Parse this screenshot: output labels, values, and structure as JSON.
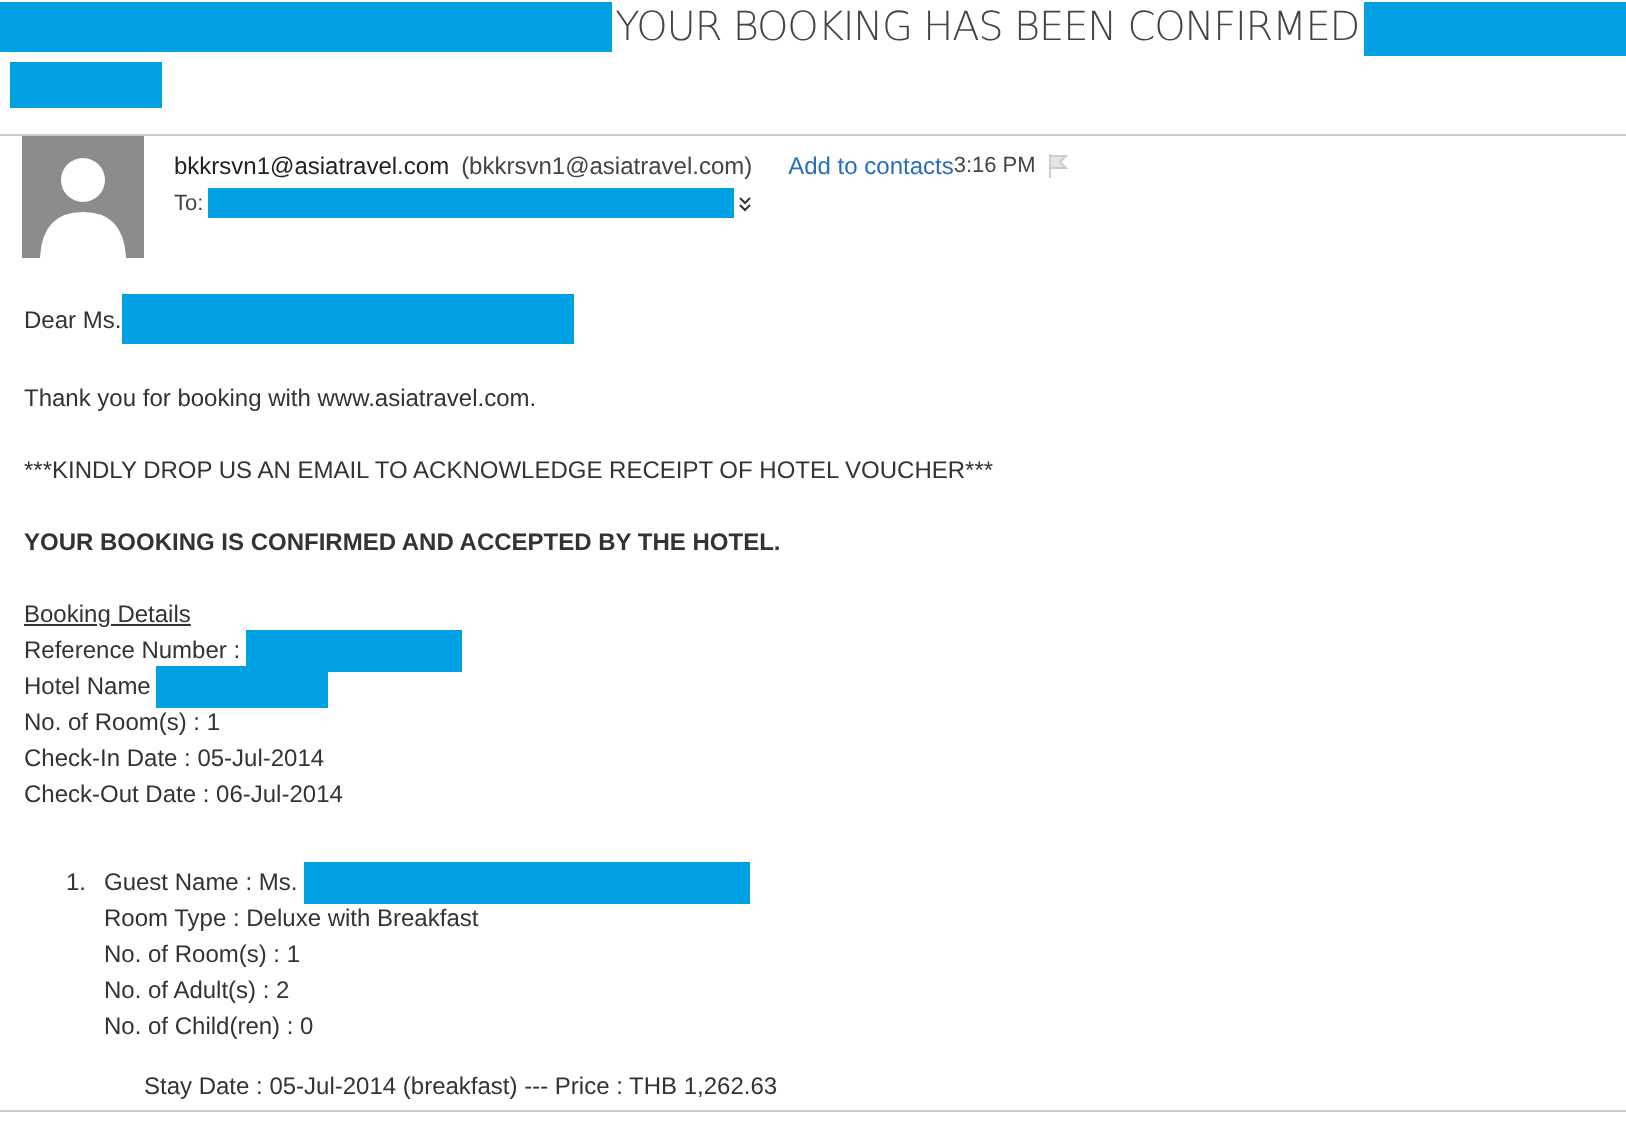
{
  "subject": "YOUR BOOKING HAS BEEN CONFIRMED",
  "header": {
    "sender": "bkkrsvn1@asiatravel.com",
    "sender_address": "(bkkrsvn1@asiatravel.com)",
    "add_contact": "Add to contacts",
    "time": "3:16 PM",
    "to_label": "To:"
  },
  "body": {
    "greeting": "Dear Ms.",
    "thanks": "Thank you for booking with www.asiatravel.com.",
    "notice": "***KINDLY DROP US AN EMAIL TO ACKNOWLEDGE RECEIPT OF HOTEL VOUCHER***",
    "confirmation": "YOUR BOOKING IS CONFIRMED AND ACCEPTED BY THE HOTEL.",
    "details_heading": "Booking Details",
    "details": [
      {
        "text": "Reference Number :",
        "redacted": true
      },
      {
        "text": "Hotel Name",
        "redacted": true
      },
      {
        "text": "No. of Room(s) : 1",
        "redacted": false
      },
      {
        "text": "Check-In Date : 05-Jul-2014",
        "redacted": false
      },
      {
        "text": "Check-Out Date : 06-Jul-2014",
        "redacted": false
      }
    ],
    "guests": [
      {
        "number": "1.",
        "lines": [
          {
            "text": "Guest Name : Ms.",
            "redacted": true
          },
          {
            "text": "Room Type : Deluxe with Breakfast",
            "redacted": false
          },
          {
            "text": "No. of Room(s) : 1",
            "redacted": false
          },
          {
            "text": "No. of Adult(s) : 2",
            "redacted": false
          },
          {
            "text": "No. of Child(ren) : 0",
            "redacted": false
          }
        ],
        "stay": "Stay Date : 05-Jul-2014 (breakfast) --- Price : THB 1,262.63"
      }
    ]
  }
}
